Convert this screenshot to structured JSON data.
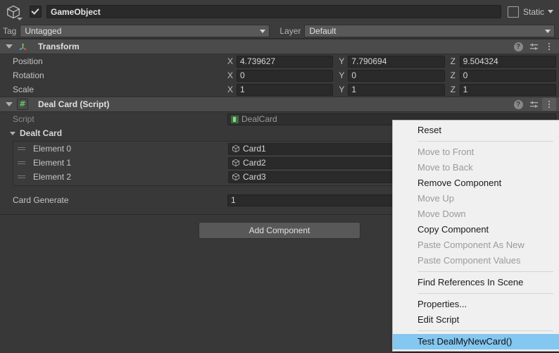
{
  "gameobject": {
    "icon": "cube-icon",
    "enabled": true,
    "name": "GameObject",
    "static_label": "Static",
    "static_checked": false,
    "tag_label": "Tag",
    "tag_value": "Untagged",
    "layer_label": "Layer",
    "layer_value": "Default"
  },
  "transform": {
    "title": "Transform",
    "icon": "transform-gizmo-icon",
    "rows": [
      {
        "label": "Position",
        "axes": [
          {
            "axis": "X",
            "value": "4.739627"
          },
          {
            "axis": "Y",
            "value": "7.790694"
          },
          {
            "axis": "Z",
            "value": "9.504324"
          }
        ]
      },
      {
        "label": "Rotation",
        "axes": [
          {
            "axis": "X",
            "value": "0"
          },
          {
            "axis": "Y",
            "value": "0"
          },
          {
            "axis": "Z",
            "value": "0"
          }
        ]
      },
      {
        "label": "Scale",
        "axes": [
          {
            "axis": "X",
            "value": "1"
          },
          {
            "axis": "Y",
            "value": "1"
          },
          {
            "axis": "Z",
            "value": "1"
          }
        ]
      }
    ]
  },
  "dealcard": {
    "title": "Deal Card (Script)",
    "icon": "csharp-script-icon",
    "icon_glyph": "#",
    "script_label": "Script",
    "script_value": "DealCard",
    "array_label": "Dealt Card",
    "elements": [
      {
        "label": "Element 0",
        "value": "Card1"
      },
      {
        "label": "Element 1",
        "value": "Card2"
      },
      {
        "label": "Element 2",
        "value": "Card3"
      }
    ],
    "card_generate_label": "Card Generate",
    "card_generate_value": "1"
  },
  "add_component": {
    "label": "Add Component"
  },
  "component_tools": {
    "help": "?",
    "help_icon": "help-circle-icon",
    "preset_icon": "preset-sliders-icon",
    "menu_icon": "kebab-menu-icon"
  },
  "context_menu": {
    "items": [
      {
        "label": "Reset",
        "state": "enabled"
      },
      {
        "type": "separator"
      },
      {
        "label": "Move to Front",
        "state": "disabled"
      },
      {
        "label": "Move to Back",
        "state": "disabled"
      },
      {
        "label": "Remove Component",
        "state": "enabled"
      },
      {
        "label": "Move Up",
        "state": "disabled"
      },
      {
        "label": "Move Down",
        "state": "disabled"
      },
      {
        "label": "Copy Component",
        "state": "enabled"
      },
      {
        "label": "Paste Component As New",
        "state": "disabled"
      },
      {
        "label": "Paste Component Values",
        "state": "disabled"
      },
      {
        "type": "separator"
      },
      {
        "label": "Find References In Scene",
        "state": "enabled"
      },
      {
        "type": "separator"
      },
      {
        "label": "Properties...",
        "state": "enabled"
      },
      {
        "label": "Edit Script",
        "state": "enabled"
      },
      {
        "type": "separator"
      },
      {
        "label": "Test DealMyNewCard()",
        "state": "selected"
      }
    ],
    "highlight_color": "#84c7f0",
    "background_color": "#f0f0f0"
  }
}
